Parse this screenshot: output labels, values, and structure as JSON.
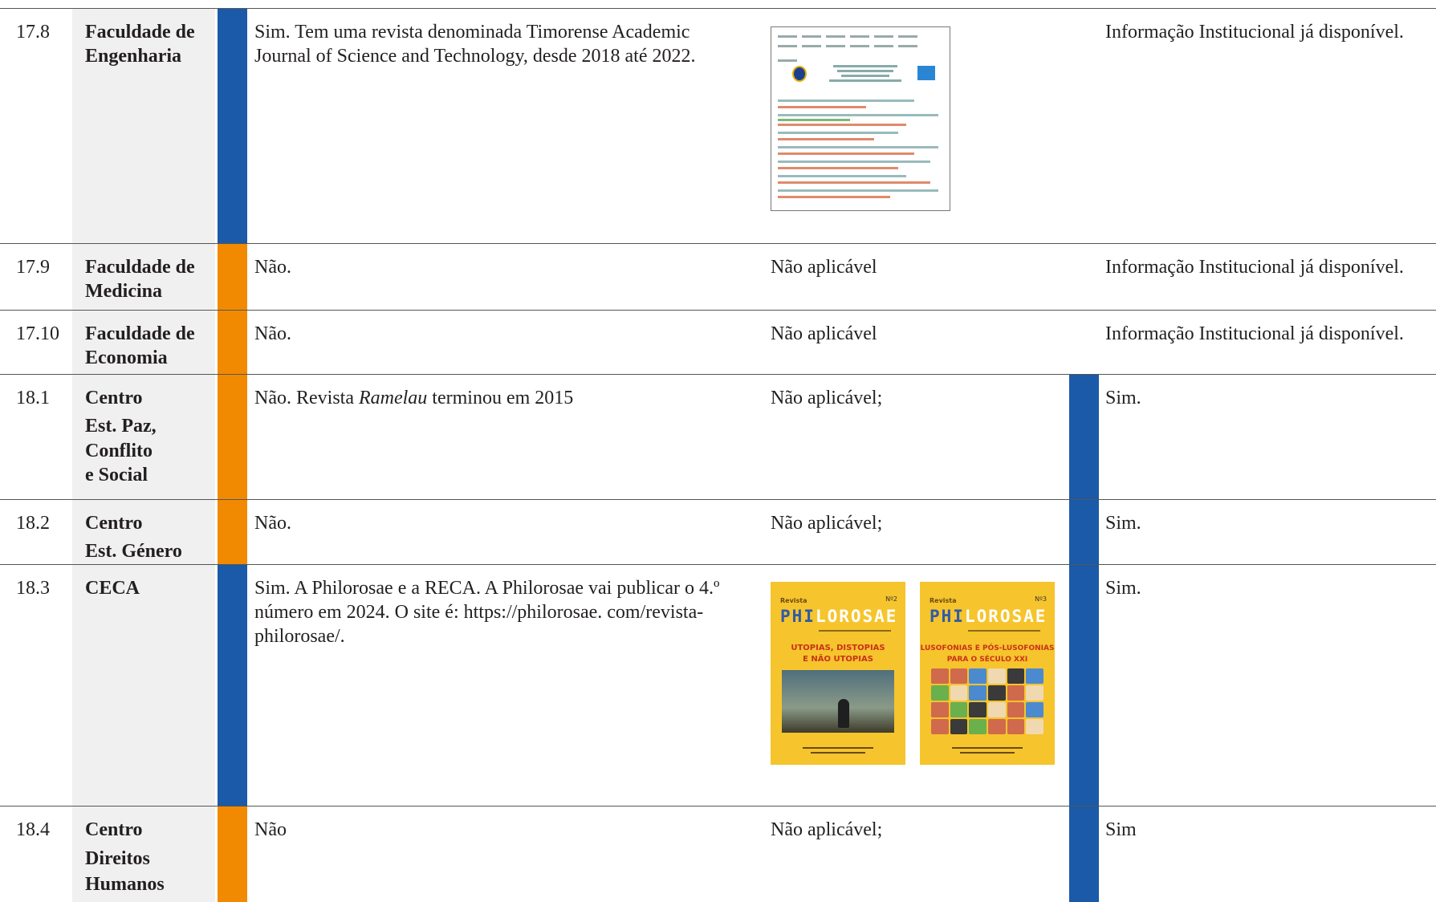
{
  "rows": [
    {
      "num": "17.8",
      "name": [
        "Faculdade de",
        "Engenharia"
      ],
      "description": "Sim. Tem uma revista denominada Timorense Academic Journal of Science and Technology, desde 2018 até 2022.",
      "applicability_image": "journal-website-screenshot",
      "institutional": "Informação Institucional já disponível."
    },
    {
      "num": "17.9",
      "name": [
        "Faculdade de",
        "Medicina"
      ],
      "description": "Não.",
      "applicability": "Não aplicável",
      "institutional": "Informação Institucional já disponível."
    },
    {
      "num": "17.10",
      "name": [
        "Faculdade de",
        "Economia"
      ],
      "description": "Não.",
      "applicability": "Não aplicável",
      "institutional": "Informação Institucional já disponível."
    },
    {
      "num": "18.1",
      "name": [
        "Centro",
        "Est. Paz,",
        "Conflito",
        "e Social"
      ],
      "description_pre": "Não. Revista ",
      "description_italic": "Ramelau",
      "description_post": " terminou em 2015",
      "applicability": "Não aplicável;",
      "institutional": "Sim."
    },
    {
      "num": "18.2",
      "name": [
        "Centro",
        "Est. Género"
      ],
      "description": "Não.",
      "applicability": "Não aplicável;",
      "institutional": "Sim."
    },
    {
      "num": "18.3",
      "name": [
        "CECA"
      ],
      "description": "Sim. A Philorosae e a RECA. A Philorosae vai publicar o 4.º número em 2024. O site é: https://philorosae. com/revista-philorosae/.",
      "covers": [
        {
          "label": "Revista",
          "number": "Nº2",
          "masthead_a": "PHI",
          "masthead_b": "LOROSAE",
          "title_lines": [
            "UTOPIAS, DISTOPIAS",
            "E NÃO UTOPIAS"
          ]
        },
        {
          "label": "Revista",
          "number": "Nº3",
          "masthead_a": "PHI",
          "masthead_b": "LOROSAE",
          "title_lines": [
            "LUSOFONIAS E PÓS-LUSOFONIAS",
            "PARA O SÉCULO XXI"
          ]
        }
      ],
      "institutional": "Sim."
    },
    {
      "num": "18.4",
      "name": [
        "Centro",
        "Direitos",
        "Humanos"
      ],
      "description": "Não",
      "applicability": "Não aplicável;",
      "institutional": "Sim"
    }
  ],
  "colors": {
    "blue_bar": "#1a5aa8",
    "orange_bar": "#f18a00",
    "name_bg": "#f0f0f0",
    "cover_yellow": "#f6c42c"
  }
}
